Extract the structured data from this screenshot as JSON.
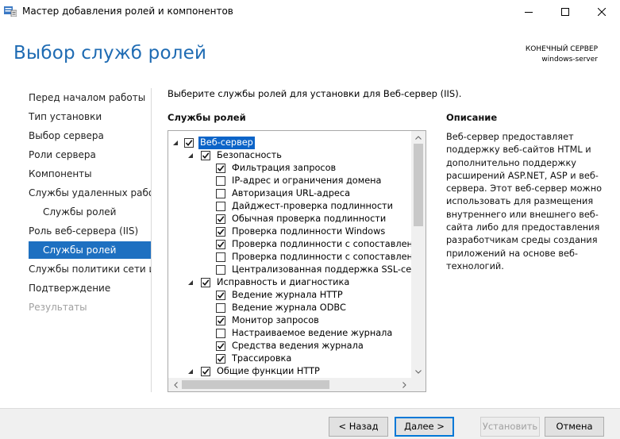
{
  "window": {
    "title": "Мастер добавления ролей и компонентов",
    "controls": {
      "minimize": "minimize-icon",
      "maximize": "maximize-icon",
      "close": "close-icon"
    }
  },
  "header": {
    "page_title": "Выбор служб ролей",
    "server_label": "КОНЕЧНЫЙ СЕРВЕР",
    "server_name": "windows-server"
  },
  "nav": [
    {
      "label": "Перед началом работы",
      "state": "normal",
      "sub": false
    },
    {
      "label": "Тип установки",
      "state": "normal",
      "sub": false
    },
    {
      "label": "Выбор сервера",
      "state": "normal",
      "sub": false
    },
    {
      "label": "Роли сервера",
      "state": "normal",
      "sub": false
    },
    {
      "label": "Компоненты",
      "state": "normal",
      "sub": false
    },
    {
      "label": "Службы удаленных рабо...",
      "state": "normal",
      "sub": false
    },
    {
      "label": "Службы ролей",
      "state": "normal",
      "sub": true
    },
    {
      "label": "Роль веб-сервера (IIS)",
      "state": "normal",
      "sub": false
    },
    {
      "label": "Службы ролей",
      "state": "active",
      "sub": true
    },
    {
      "label": "Службы политики сети и...",
      "state": "normal",
      "sub": false
    },
    {
      "label": "Подтверждение",
      "state": "normal",
      "sub": false
    },
    {
      "label": "Результаты",
      "state": "disabled",
      "sub": false
    }
  ],
  "main": {
    "instruction": "Выберите службы ролей для установки для Веб-сервер (IIS).",
    "services_heading": "Службы ролей",
    "tree": [
      {
        "label": "Веб-сервер",
        "level": 0,
        "expanded": true,
        "checked": true,
        "selected": true
      },
      {
        "label": "Безопасность",
        "level": 1,
        "expanded": true,
        "checked": true
      },
      {
        "label": "Фильтрация запросов",
        "level": 2,
        "checked": true
      },
      {
        "label": "IP-адрес и ограничения домена",
        "level": 2,
        "checked": false
      },
      {
        "label": "Авторизация URL-адреса",
        "level": 2,
        "checked": false
      },
      {
        "label": "Дайджест-проверка подлинности",
        "level": 2,
        "checked": false
      },
      {
        "label": "Обычная проверка подлинности",
        "level": 2,
        "checked": true
      },
      {
        "label": "Проверка подлинности Windows",
        "level": 2,
        "checked": true
      },
      {
        "label": "Проверка подлинности с сопоставлением",
        "level": 2,
        "checked": true
      },
      {
        "label": "Проверка подлинности с сопоставлением",
        "level": 2,
        "checked": false
      },
      {
        "label": "Централизованная поддержка SSL-серти",
        "level": 2,
        "checked": false
      },
      {
        "label": "Исправность и диагностика",
        "level": 1,
        "expanded": true,
        "checked": true
      },
      {
        "label": "Ведение журнала HTTP",
        "level": 2,
        "checked": true
      },
      {
        "label": "Ведение журнала ODBC",
        "level": 2,
        "checked": false
      },
      {
        "label": "Монитор запросов",
        "level": 2,
        "checked": true
      },
      {
        "label": "Настраиваемое ведение журнала",
        "level": 2,
        "checked": false
      },
      {
        "label": "Средства ведения журнала",
        "level": 2,
        "checked": true
      },
      {
        "label": "Трассировка",
        "level": 2,
        "checked": true
      },
      {
        "label": "Общие функции HTTP",
        "level": 1,
        "expanded": true,
        "checked": true
      }
    ]
  },
  "description": {
    "heading": "Описание",
    "lines": [
      "Веб-сервер предоставляет",
      "поддержку веб-сайтов HTML и",
      "дополнительно поддержку",
      "расширений ASP.NET, ASP и веб-",
      "сервера. Этот веб-сервер можно",
      "использовать для размещения",
      "внутреннего или внешнего веб-",
      "сайта либо для предоставления",
      "разработчикам среды создания",
      "приложений на основе веб-",
      "технологий."
    ]
  },
  "footer": {
    "back_label": "< Назад",
    "next_label": "Далее >",
    "install_label": "Установить",
    "cancel_label": "Отмена"
  },
  "colors": {
    "title_blue": "#1e6bb3",
    "nav_active_bg": "#1e70c1",
    "selection_bg": "#0c64c8",
    "footer_bg": "#f0f0f0",
    "focus_border": "#0078d7"
  }
}
